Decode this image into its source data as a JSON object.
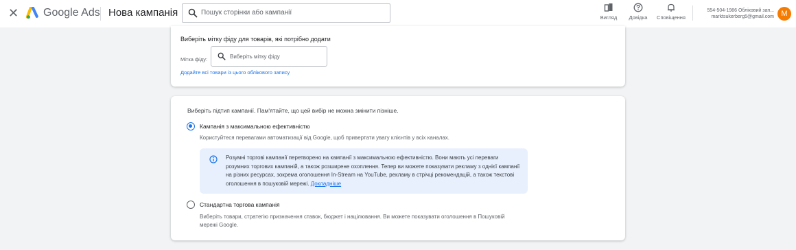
{
  "header": {
    "close_icon": "close-icon",
    "brand": "Google Ads",
    "page_title": "Нова кампанія",
    "search_placeholder": "Пошук сторінки або кампанії",
    "view_label": "Вигляд",
    "help_label": "Довідка",
    "notifications_label": "Сповіщення",
    "account_line1": "554-504-1986 Обліковий зап...",
    "account_line2": "marktsukerberg5@gmail.com",
    "avatar_letter": "M",
    "avatar_color": "#f57c00"
  },
  "feed_card": {
    "instruction": "Виберіть мітку фіду для товарів, які потрібно додати",
    "field_label": "Мітка фіду:",
    "field_placeholder": "Виберіть мітку фіду",
    "add_all_link": "Додайте всі товари із цього облікового запису"
  },
  "subtype_card": {
    "question": "Виберіть підтип кампанії. Пам'ятайте, що цей вибір не можна змінити пізніше.",
    "options": [
      {
        "title": "Кампанія з максимальною ефективністю",
        "description": "Користуйтеся перевагами автоматизації від Google, щоб привертати увагу клієнтів у всіх каналах.",
        "selected": true
      },
      {
        "title": "Стандартна торгова кампанія",
        "description": "Виберіть товари, стратегію призначення ставок, бюджет і націлювання. Ви можете показувати оголошення в Пошуковій мережі Google.",
        "selected": false
      }
    ],
    "info_text": "Розумні торгові кампанії перетворено на кампанії з максимальною ефективністю. Вони мають усі переваги розумних торгових кампаній, а також розширене охоплення. Тепер ви можете показувати рекламу з однієї кампанії на різних ресурсах, зокрема оголошення In-Stream на YouTube, рекламу в стрічці рекомендацій, а також текстові оголошення в пошуковій мережі.",
    "info_link": "Докладніше"
  },
  "colors": {
    "accent": "#1a73e8",
    "info_bg": "#e8f0fe"
  }
}
